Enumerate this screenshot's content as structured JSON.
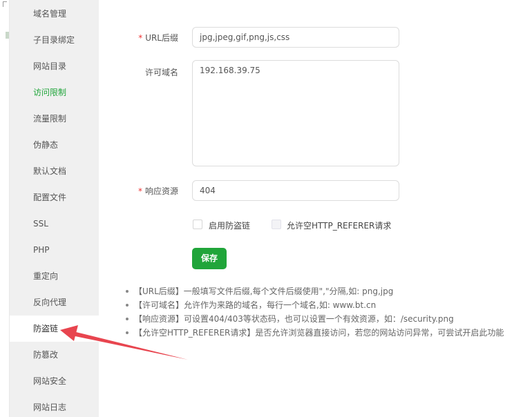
{
  "sidebar": {
    "items": [
      {
        "label": "域名管理"
      },
      {
        "label": "子目录绑定"
      },
      {
        "label": "网站目录"
      },
      {
        "label": "访问限制"
      },
      {
        "label": "流量限制"
      },
      {
        "label": "伪静态"
      },
      {
        "label": "默认文档"
      },
      {
        "label": "配置文件"
      },
      {
        "label": "SSL"
      },
      {
        "label": "PHP"
      },
      {
        "label": "重定向"
      },
      {
        "label": "反向代理"
      },
      {
        "label": "防盗链"
      },
      {
        "label": "防篡改"
      },
      {
        "label": "网站安全"
      },
      {
        "label": "网站日志"
      }
    ],
    "highlighted_item": "访问限制",
    "selected_item": "防盗链"
  },
  "form": {
    "required_mark": "*",
    "url_suffix": {
      "label": "URL后缀",
      "value": "jpg,jpeg,gif,png,js,css"
    },
    "allowed_domains": {
      "label": "许可域名",
      "value": "192.168.39.75"
    },
    "response_resource": {
      "label": "响应资源",
      "value": "404"
    },
    "enable_hotlink_protection": {
      "label": "启用防盗链",
      "checked": false
    },
    "allow_empty_referer": {
      "label": "允许空HTTP_REFERER请求",
      "checked": false,
      "disabled": true
    },
    "save_label": "保存"
  },
  "tips": [
    {
      "text": "【URL后缀】一般填写文件后缀,每个文件后缀使用\",\"分隔,如: png,jpg"
    },
    {
      "text": "【许可域名】允许作为来路的域名，每行一个域名,如: www.bt.cn"
    },
    {
      "text": "【响应资源】可设置404/403等状态码，也可以设置一个有效资源，如：/security.png"
    },
    {
      "text": "【允许空HTTP_REFERER请求】是否允许浏览器直接访问，若您的网站访问异常，可尝试开启此功能"
    }
  ],
  "colors": {
    "accent": "#20a53a",
    "required": "#ee3333",
    "annotation_arrow": "#e8454f"
  },
  "icons": {
    "annotation": "red-pointer-arrow-icon"
  }
}
